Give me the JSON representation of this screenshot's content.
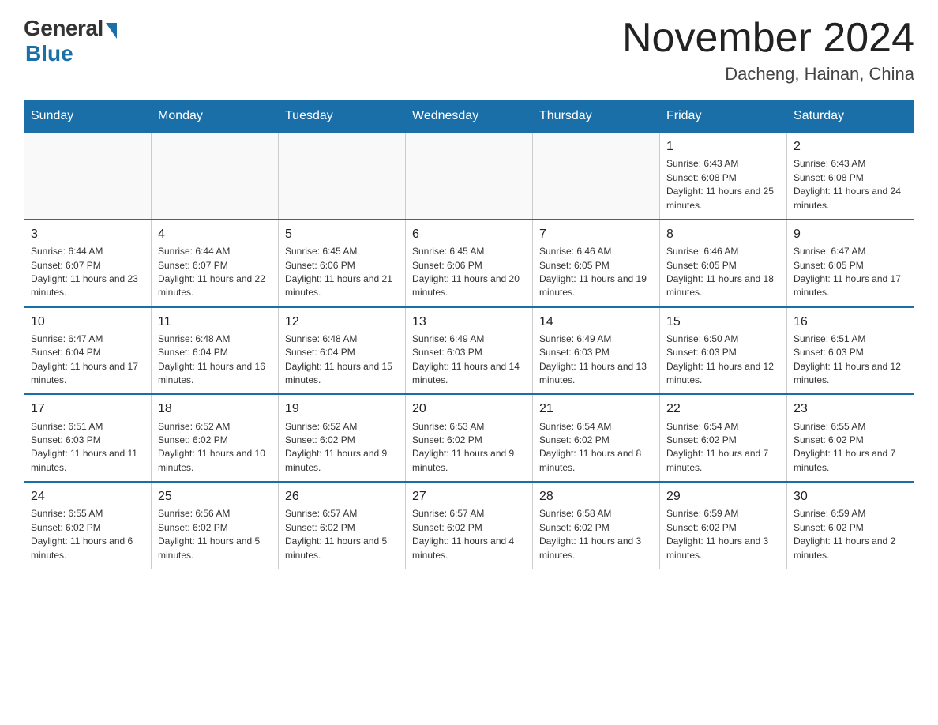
{
  "logo": {
    "general": "General",
    "blue": "Blue"
  },
  "header": {
    "title": "November 2024",
    "location": "Dacheng, Hainan, China"
  },
  "days_of_week": [
    "Sunday",
    "Monday",
    "Tuesday",
    "Wednesday",
    "Thursday",
    "Friday",
    "Saturday"
  ],
  "weeks": [
    [
      {
        "day": "",
        "info": ""
      },
      {
        "day": "",
        "info": ""
      },
      {
        "day": "",
        "info": ""
      },
      {
        "day": "",
        "info": ""
      },
      {
        "day": "",
        "info": ""
      },
      {
        "day": "1",
        "info": "Sunrise: 6:43 AM\nSunset: 6:08 PM\nDaylight: 11 hours and 25 minutes."
      },
      {
        "day": "2",
        "info": "Sunrise: 6:43 AM\nSunset: 6:08 PM\nDaylight: 11 hours and 24 minutes."
      }
    ],
    [
      {
        "day": "3",
        "info": "Sunrise: 6:44 AM\nSunset: 6:07 PM\nDaylight: 11 hours and 23 minutes."
      },
      {
        "day": "4",
        "info": "Sunrise: 6:44 AM\nSunset: 6:07 PM\nDaylight: 11 hours and 22 minutes."
      },
      {
        "day": "5",
        "info": "Sunrise: 6:45 AM\nSunset: 6:06 PM\nDaylight: 11 hours and 21 minutes."
      },
      {
        "day": "6",
        "info": "Sunrise: 6:45 AM\nSunset: 6:06 PM\nDaylight: 11 hours and 20 minutes."
      },
      {
        "day": "7",
        "info": "Sunrise: 6:46 AM\nSunset: 6:05 PM\nDaylight: 11 hours and 19 minutes."
      },
      {
        "day": "8",
        "info": "Sunrise: 6:46 AM\nSunset: 6:05 PM\nDaylight: 11 hours and 18 minutes."
      },
      {
        "day": "9",
        "info": "Sunrise: 6:47 AM\nSunset: 6:05 PM\nDaylight: 11 hours and 17 minutes."
      }
    ],
    [
      {
        "day": "10",
        "info": "Sunrise: 6:47 AM\nSunset: 6:04 PM\nDaylight: 11 hours and 17 minutes."
      },
      {
        "day": "11",
        "info": "Sunrise: 6:48 AM\nSunset: 6:04 PM\nDaylight: 11 hours and 16 minutes."
      },
      {
        "day": "12",
        "info": "Sunrise: 6:48 AM\nSunset: 6:04 PM\nDaylight: 11 hours and 15 minutes."
      },
      {
        "day": "13",
        "info": "Sunrise: 6:49 AM\nSunset: 6:03 PM\nDaylight: 11 hours and 14 minutes."
      },
      {
        "day": "14",
        "info": "Sunrise: 6:49 AM\nSunset: 6:03 PM\nDaylight: 11 hours and 13 minutes."
      },
      {
        "day": "15",
        "info": "Sunrise: 6:50 AM\nSunset: 6:03 PM\nDaylight: 11 hours and 12 minutes."
      },
      {
        "day": "16",
        "info": "Sunrise: 6:51 AM\nSunset: 6:03 PM\nDaylight: 11 hours and 12 minutes."
      }
    ],
    [
      {
        "day": "17",
        "info": "Sunrise: 6:51 AM\nSunset: 6:03 PM\nDaylight: 11 hours and 11 minutes."
      },
      {
        "day": "18",
        "info": "Sunrise: 6:52 AM\nSunset: 6:02 PM\nDaylight: 11 hours and 10 minutes."
      },
      {
        "day": "19",
        "info": "Sunrise: 6:52 AM\nSunset: 6:02 PM\nDaylight: 11 hours and 9 minutes."
      },
      {
        "day": "20",
        "info": "Sunrise: 6:53 AM\nSunset: 6:02 PM\nDaylight: 11 hours and 9 minutes."
      },
      {
        "day": "21",
        "info": "Sunrise: 6:54 AM\nSunset: 6:02 PM\nDaylight: 11 hours and 8 minutes."
      },
      {
        "day": "22",
        "info": "Sunrise: 6:54 AM\nSunset: 6:02 PM\nDaylight: 11 hours and 7 minutes."
      },
      {
        "day": "23",
        "info": "Sunrise: 6:55 AM\nSunset: 6:02 PM\nDaylight: 11 hours and 7 minutes."
      }
    ],
    [
      {
        "day": "24",
        "info": "Sunrise: 6:55 AM\nSunset: 6:02 PM\nDaylight: 11 hours and 6 minutes."
      },
      {
        "day": "25",
        "info": "Sunrise: 6:56 AM\nSunset: 6:02 PM\nDaylight: 11 hours and 5 minutes."
      },
      {
        "day": "26",
        "info": "Sunrise: 6:57 AM\nSunset: 6:02 PM\nDaylight: 11 hours and 5 minutes."
      },
      {
        "day": "27",
        "info": "Sunrise: 6:57 AM\nSunset: 6:02 PM\nDaylight: 11 hours and 4 minutes."
      },
      {
        "day": "28",
        "info": "Sunrise: 6:58 AM\nSunset: 6:02 PM\nDaylight: 11 hours and 3 minutes."
      },
      {
        "day": "29",
        "info": "Sunrise: 6:59 AM\nSunset: 6:02 PM\nDaylight: 11 hours and 3 minutes."
      },
      {
        "day": "30",
        "info": "Sunrise: 6:59 AM\nSunset: 6:02 PM\nDaylight: 11 hours and 2 minutes."
      }
    ]
  ]
}
